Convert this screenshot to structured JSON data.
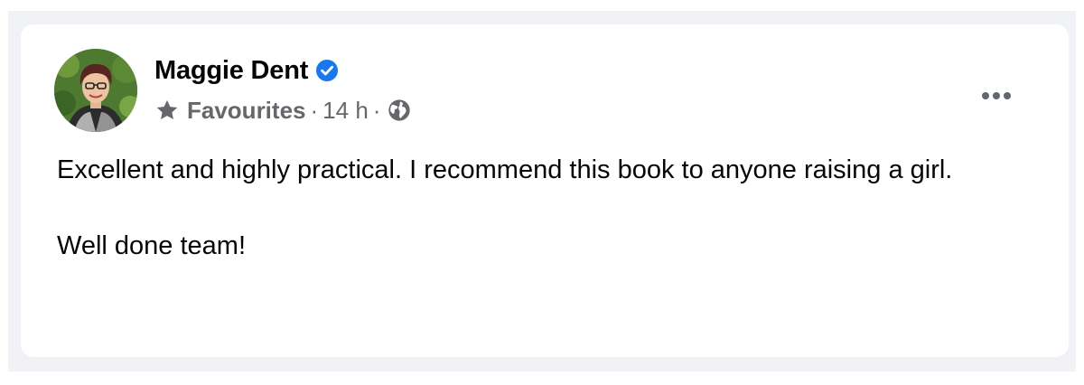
{
  "post": {
    "author_name": "Maggie Dent",
    "verified": true,
    "audience_label": "Favourites",
    "separator": "·",
    "timestamp": "14 h",
    "privacy_icon": "globe-icon",
    "paragraphs": [
      "Excellent and highly practical. I recommend this book to anyone raising a girl.",
      "Well done team!"
    ]
  },
  "colors": {
    "verified_blue": "#1877f2",
    "meta_gray": "#65676b",
    "text": "#050505",
    "background": "#f0f2f5"
  }
}
